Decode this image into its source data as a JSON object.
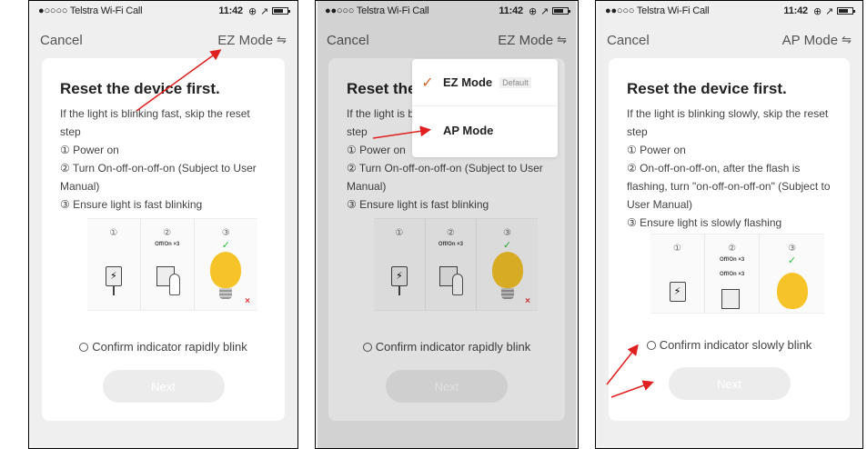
{
  "colors": {
    "accent_arrow": "#e02020",
    "check": "#2bbf3a",
    "bulb": "#f6c329",
    "dropdown_tick": "#d06a2a"
  },
  "panels": [
    {
      "status": {
        "carrier": "●○○○○ Telstra Wi-Fi Call",
        "time": "11:42"
      },
      "nav": {
        "cancel": "Cancel",
        "mode": "EZ Mode"
      },
      "card": {
        "title": "Reset the device first.",
        "lines": [
          "If the light is blinking fast, skip the reset step",
          "① Power on",
          "② Turn On-off-on-off-on (Subject to User Manual)",
          "③ Ensure light is fast blinking"
        ],
        "illus": {
          "n1": "①",
          "n2": "②",
          "n3": "③",
          "sub2": "Off/On ×3",
          "sub2b": "",
          "check": "✓",
          "x": "×"
        },
        "confirm": "Confirm indicator rapidly blink",
        "next": "Next"
      }
    },
    {
      "status": {
        "carrier": "●●○○○ Telstra Wi-Fi Call",
        "time": "11:42"
      },
      "nav": {
        "cancel": "Cancel",
        "mode": "EZ Mode"
      },
      "card": {
        "title": "Reset the",
        "lines": [
          "If the light is b",
          "step",
          "① Power on",
          "② Turn On-off-on-off-on (Subject to User Manual)",
          "③ Ensure light is fast blinking"
        ],
        "illus": {
          "n1": "①",
          "n2": "②",
          "n3": "③",
          "sub2": "Off/On ×3",
          "sub2b": "",
          "check": "✓",
          "x": "×"
        },
        "confirm": "Confirm indicator rapidly blink",
        "next": "Next"
      },
      "dropdown": {
        "item1": "EZ Mode",
        "item1_badge": "Default",
        "item2": "AP Mode",
        "tick": "✓"
      }
    },
    {
      "status": {
        "carrier": "●●○○○ Telstra Wi-Fi Call",
        "time": "11:42"
      },
      "nav": {
        "cancel": "Cancel",
        "mode": "AP Mode"
      },
      "card": {
        "title": "Reset the device first.",
        "lines": [
          "If the light is blinking slowly, skip the reset step",
          "① Power on",
          "② On-off-on-off-on, after the flash is flashing, turn \"on-off-on-off-on\" (Subject to User Manual)",
          "③ Ensure  light is slowly flashing"
        ],
        "illus": {
          "n1": "①",
          "n2": "②",
          "n3": "③",
          "sub2": "Off/On ×3",
          "sub2b": "Off/On ×3",
          "check": "✓",
          "x": ""
        },
        "confirm": "Confirm indicator slowly blink",
        "next": "Next"
      }
    }
  ]
}
